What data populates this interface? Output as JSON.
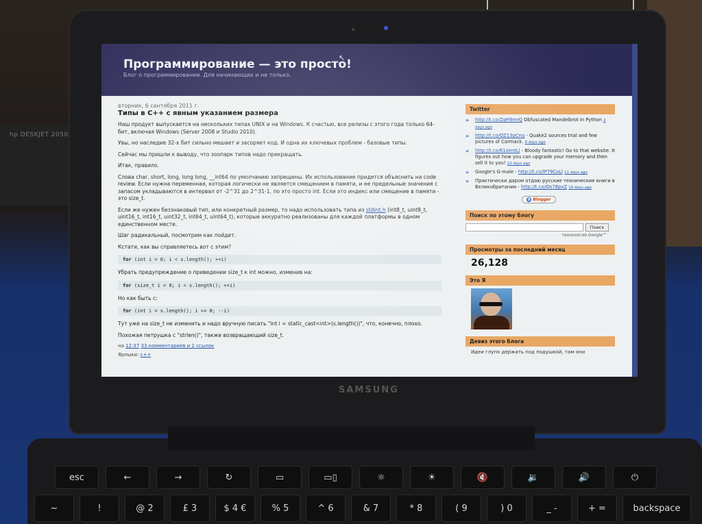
{
  "scene": {
    "printer_text": "hp DESKJET 2050A",
    "laptop_brand": "SAMSUNG"
  },
  "blog": {
    "title": "Программирование — это просто!",
    "description": "Блог о программировании. Для начинающих и не только."
  },
  "post": {
    "date": "вторник, 6 сентября 2011 г.",
    "title": "Типы в C++ с явным указанием размера",
    "p1": "Наш продукт выпускается на нескольких типах UNIX и на Windows. К счастью, все релизы с этого года только 64-бит, включая Windows (Server 2008 и Studio 2010).",
    "p2": "Увы, но наследие 32-х бит сильно мешает и засоряет код. И одна их ключевых проблем - базовые типы.",
    "p3": "Сейчас мы пришли к выводу, что зоопарк типов надо прекращать.",
    "p4": "Итак, правило.",
    "p5": "Слова char, short, long, long long, __int64 по умолчанию запрещены. Их использование придется объяснить на code review. Если нужна переменная, которая логически не является смещением в памяти, и ее предельные значения с запасом укладываются в интервал от -2^31 до 2^31-1, по это просто int. Если это индекс или смещение в памяти - это size_t.",
    "p6_before": "Если же нужен беззнаковый тип, или конкретный размер, то надо использовать типа из ",
    "p6_link": "stdint.h",
    "p6_after": " (int8_t, uint8_t, uint16_t, int16_t, uint32_t, int64_t, uint64_t), которые аккуратно реализованы для каждой платформы в одном единственном месте.",
    "p7": "Шаг радикальный, посмотрим как пойдет.",
    "p8": "Кстати, как вы справляетесь вот с этим?",
    "code1_kw": "for",
    "code1": " (int i = 0; i < s.length(); ++i)",
    "p9": "Убрать предупреждение о приведении size_t к int можно, изменив на:",
    "code2_kw": "for",
    "code2": " (size_t i = 0; i < s.length(); ++i)",
    "p10": "Но как быть с:",
    "code3_kw": "for",
    "code3": " (int i = s.length(); i >= 0; --i)",
    "p11": "Тут уже на size_t не изменить и надо вручную писать \"int i = static_cast<int>(s.length())\", что, конечно, плохо.",
    "p12": "Похожая петрушка с \"strlen()\", также возвращающий size_t.",
    "footer_prefix": "на ",
    "footer_time": "12:37",
    "footer_comments": "33 комментариев и 2 ссылок",
    "labels_prefix": "Ярлыки: ",
    "labels_link": "c++"
  },
  "sidebar": {
    "twitter_title": "Twitter",
    "tweets": [
      {
        "link": "http://t.co/ZqH9mrQ",
        "text": " Obfuscated Mandelbrot in Python ",
        "time": "2 days ago"
      },
      {
        "link": "http://t.co/OZ13pCnq",
        "text": " - Quake2 sources trial and few pictures of Carmack. ",
        "time": "9 days ago"
      },
      {
        "link": "http://t.co/61xImtLi",
        "text": " - Bloody fantastic! Go to that website. It figures out how you can upgrade your memory and then sell it to you! ",
        "time": "10 days ago"
      },
      {
        "link": "http://t.co/lP79CoLl",
        "text": "Google's G-male - ",
        "time": "11 days ago",
        "link_after": true
      },
      {
        "link": "http://t.co/On78pxZ",
        "text": "Практически даром отдаю русские технические книги в Великобритании - ",
        "time": "19 days ago",
        "link_after": true
      }
    ],
    "blogger_badge": "Blogger",
    "search_title": "Поиск по этому блогу",
    "search_placeholder": "",
    "search_button": "Поиск",
    "search_powered": "технология Google™",
    "pageviews_title": "Просмотры за последний месяц",
    "pageviews_count": "26,128",
    "about_title": "Это Я",
    "motto_title": "Девиз этого блога",
    "motto_text": "Идеи глупо держать под подушкой, там они"
  },
  "keyboard": {
    "row1": [
      "esc",
      "←",
      "→",
      "↻",
      "▭",
      "▭▯",
      "☼",
      "☀",
      "🔇",
      "🔉",
      "🔊",
      "⏻"
    ],
    "row2": [
      "~",
      "!",
      "@ 2",
      "£ 3",
      "$ 4 €",
      "% 5",
      "^ 6",
      "& 7",
      "* 8",
      "( 9",
      ") 0",
      "_ -",
      "+ =",
      "backspace"
    ]
  }
}
